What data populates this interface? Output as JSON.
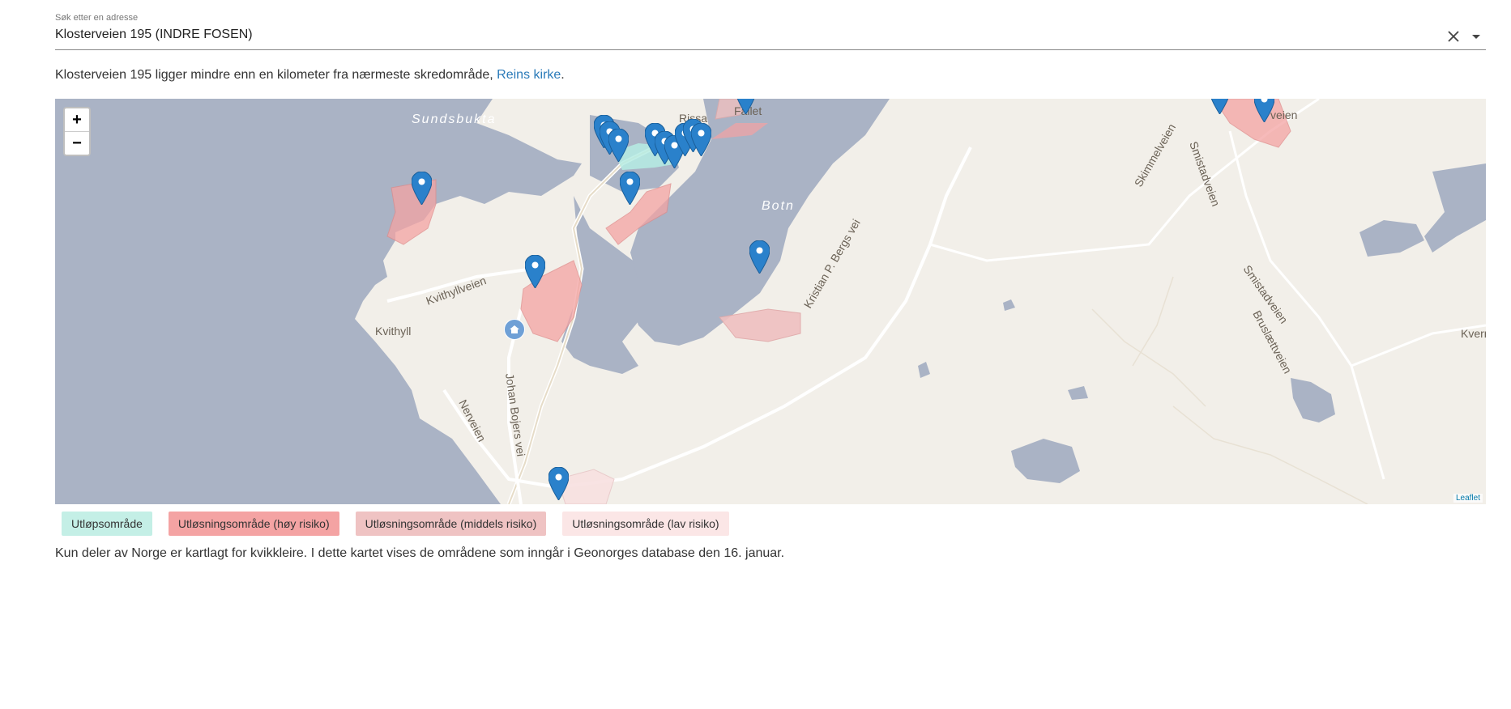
{
  "search": {
    "label": "Søk etter en adresse",
    "value": "Klosterveien 195 (INDRE FOSEN)"
  },
  "info": {
    "text_before": "Klosterveien 195 ligger mindre enn en kilometer fra nærmeste skredområde, ",
    "link": "Reins kirke",
    "text_after": "."
  },
  "map": {
    "zoom_in": "+",
    "zoom_out": "−",
    "attribution": "Leaflet",
    "labels": {
      "sundsbukta": "Sundsbukta",
      "rissa": "Rissa",
      "fallet": "Fallet",
      "botn": "Botn",
      "kvithyll": "Kvithyll",
      "kvithyllveien": "Kvithyllveien",
      "nerveien": "Nerveien",
      "johan_bojers_vei": "Johan Bojers vei",
      "kristian_p_bergs_vei": "Kristian P. Bergs vei",
      "skimmelveien": "Skimmelveien",
      "smistadveien_1": "Smistadveien",
      "smistadveien_2": "Smistadveien",
      "bruslaettveien": "Bruslættveien",
      "kvern": "Kvern",
      "veien": "veien"
    },
    "colors": {
      "water": "#aab3c5",
      "land": "#f2efe9",
      "high_risk": "#f4a3a3",
      "medium_risk": "#efc0c0",
      "low_risk": "#f8e1e1",
      "runout": "#b6ece3",
      "marker": "#2a81cb"
    }
  },
  "legend": [
    {
      "label": "Utløpsområde",
      "color": "#c4efe6"
    },
    {
      "label": "Utløsningsområde (høy risiko)",
      "color": "#f4a3a3"
    },
    {
      "label": "Utløsningsområde (middels risiko)",
      "color": "#efc3c3"
    },
    {
      "label": "Utløsningsområde (lav risiko)",
      "color": "#fbe6e6"
    }
  ],
  "note": "Kun deler av Norge er kartlagt for kvikkleire. I dette kartet vises de områdene som inngår i Geonorges database den 16. januar."
}
